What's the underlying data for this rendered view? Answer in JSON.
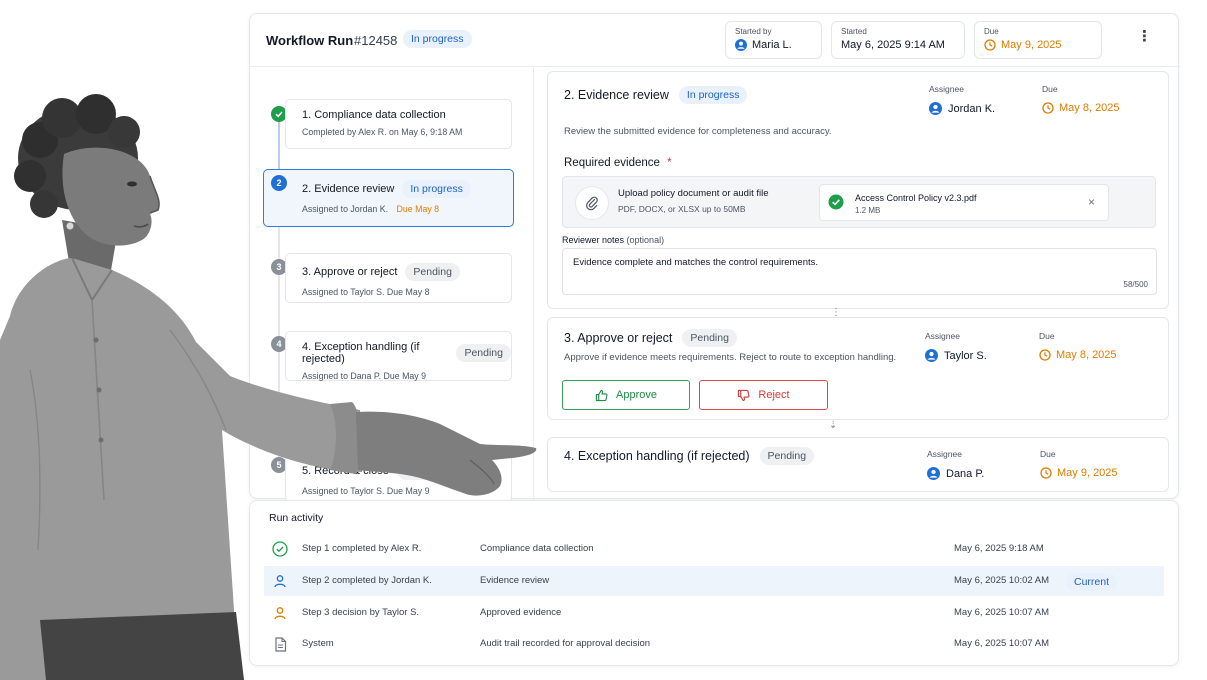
{
  "header": {
    "title": "Workflow Run",
    "run_id": "#12458",
    "status": "In progress",
    "started_by_label": "Started by",
    "started_by": "Maria L.",
    "started_label": "Started",
    "started": "May 6, 2025 9:14 AM",
    "due_label": "Due",
    "due": "May 9, 2025",
    "menu_icon": "more-vertical-icon"
  },
  "steps": [
    {
      "num": "1",
      "title": "1. Compliance data collection",
      "sub": "Completed by Alex R. on May 6, 9:18 AM",
      "state": "done"
    },
    {
      "num": "2",
      "title": "2. Evidence review",
      "badge": "In progress",
      "sub": "Assigned to Jordan K.",
      "due": "Due May 8",
      "state": "active"
    },
    {
      "num": "3",
      "title": "3. Approve or reject",
      "badge": "Pending",
      "sub": "Assigned to Taylor S.   Due May 8",
      "state": "pending"
    },
    {
      "num": "4",
      "title": "4. Exception handling (if rejected)",
      "badge": "Pending",
      "sub": "Assigned to Dana P.   Due May 9",
      "state": "pending"
    },
    {
      "num": "5",
      "title": "5. Record & close",
      "badge": "Pending",
      "sub": "Assigned to Taylor S.   Due May 9",
      "state": "pending"
    }
  ],
  "review": {
    "title": "2. Evidence review",
    "badge": "In progress",
    "assignee_label": "Assignee",
    "assignee": "Jordan K.",
    "due_label": "Due",
    "due": "May 8, 2025",
    "description": "Review the submitted evidence for completeness and accuracy.",
    "required_label": "Required evidence",
    "required_mark": "*",
    "upload_title": "Upload policy document or audit file",
    "upload_hint": "PDF, DOCX, or XLSX up to 50MB",
    "file_name": "Access Control Policy v2.3.pdf",
    "file_size": "1.2 MB",
    "notes_label": "Reviewer notes",
    "notes_optional": "(optional)",
    "notes_value": "Evidence complete and matches the control requirements.",
    "notes_count": "58/500"
  },
  "approve": {
    "title": "3. Approve or reject",
    "badge": "Pending",
    "assignee_label": "Assignee",
    "assignee": "Taylor S.",
    "due_label": "Due",
    "due": "May 8, 2025",
    "description": "Approve if evidence meets requirements. Reject to route to exception handling.",
    "approve_label": "Approve",
    "reject_label": "Reject"
  },
  "exception": {
    "title": "4. Exception handling (if rejected)",
    "badge": "Pending",
    "assignee_label": "Assignee",
    "assignee": "Dana P.",
    "due_label": "Due",
    "due": "May 9, 2025"
  },
  "activity": {
    "title": "Run activity",
    "rows": [
      {
        "text": "Step 1 completed by Alex R.",
        "desc": "Compliance data collection",
        "time": "May 6, 2025  9:18 AM",
        "icon": "check-circle-icon"
      },
      {
        "text": "Step 2 completed by Jordan K.",
        "desc": "Evidence review",
        "time": "May 6, 2025  10:02 AM",
        "badge": "Current",
        "icon": "user-icon"
      },
      {
        "text": "Step 3 decision by Taylor S.",
        "desc": "Approved evidence",
        "time": "May 6, 2025  10:07 AM",
        "icon": "user-icon"
      },
      {
        "text": "System",
        "desc": "Audit trail recorded for approval decision",
        "time": "May 6, 2025  10:07 AM",
        "icon": "document-icon"
      }
    ]
  },
  "colors": {
    "accent": "#1f6fd6",
    "success": "#1e9e4a",
    "danger": "#d03a3a",
    "due": "#e07a00"
  }
}
